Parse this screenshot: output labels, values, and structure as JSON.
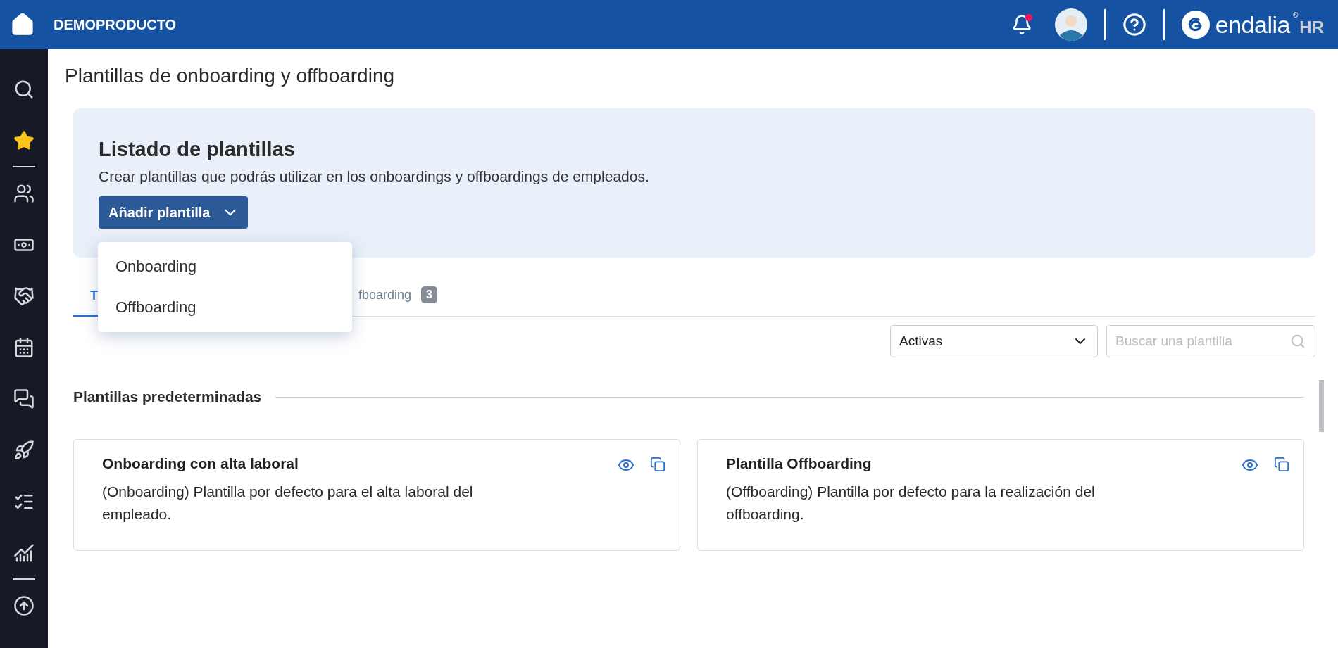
{
  "topbar": {
    "brand": "DEMOPRODUCTO",
    "notifications": {
      "unread": true
    },
    "logo": {
      "name": "endalia",
      "suffix": "HR",
      "mark": "®"
    }
  },
  "page": {
    "title": "Plantillas de onboarding y offboarding"
  },
  "banner": {
    "title": "Listado de plantillas",
    "description": "Crear plantillas que podrás utilizar en los onboardings y offboardings de empleados.",
    "add_button": {
      "label": "Añadir plantilla",
      "expanded": true
    },
    "menu": [
      {
        "label": "Onboarding"
      },
      {
        "label": "Offboarding"
      }
    ]
  },
  "tabs": [
    {
      "label": "T",
      "selected": true
    },
    {
      "label": "fboarding",
      "badge": "3",
      "selected": false
    }
  ],
  "filters": {
    "status": {
      "value": "Activas"
    },
    "search": {
      "placeholder": "Buscar una plantilla"
    }
  },
  "section": {
    "title": "Plantillas predeterminadas"
  },
  "cards": [
    {
      "title": "Onboarding con alta laboral",
      "description": "(Onboarding) Plantilla por defecto para el alta laboral del empleado."
    },
    {
      "title": "Plantilla Offboarding",
      "description": "(Offboarding) Plantilla por defecto para la realización del offboarding."
    }
  ]
}
